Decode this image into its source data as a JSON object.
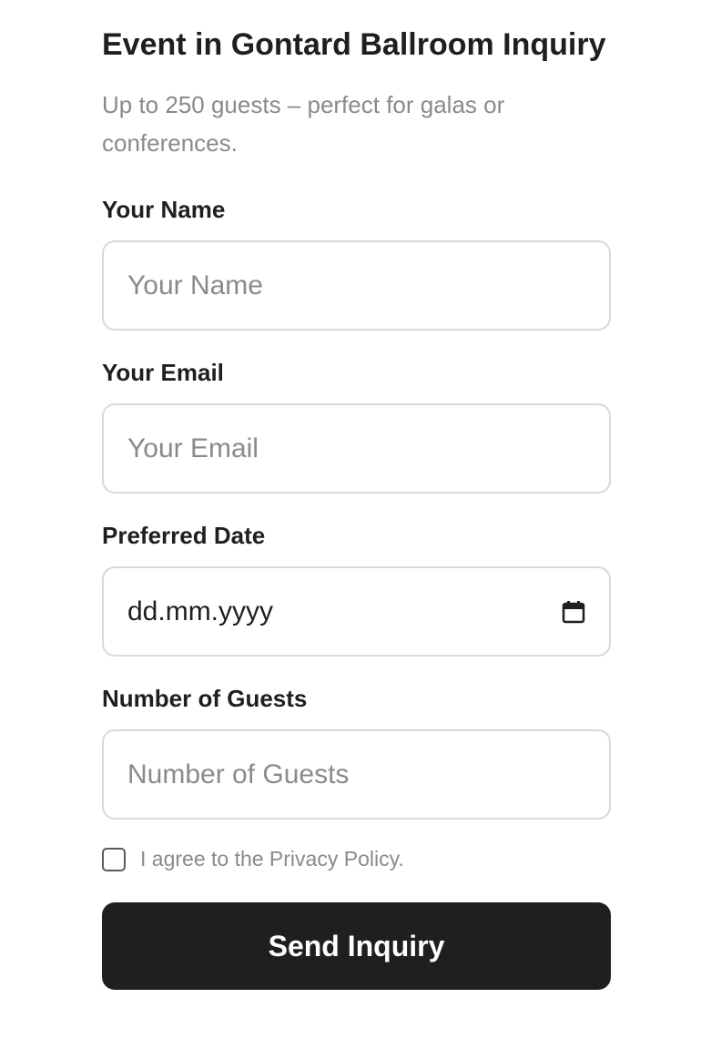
{
  "form": {
    "title": "Event in Gontard Ballroom Inquiry",
    "subtitle": "Up to 250 guests – perfect for galas or conferences.",
    "fields": {
      "name": {
        "label": "Your Name",
        "placeholder": "Your Name",
        "value": ""
      },
      "email": {
        "label": "Your Email",
        "placeholder": "Your Email",
        "value": ""
      },
      "date": {
        "label": "Preferred Date",
        "display": "dd.mm.yyyy",
        "icon": "calendar-icon"
      },
      "guests": {
        "label": "Number of Guests",
        "placeholder": "Number of Guests",
        "value": ""
      }
    },
    "consent": {
      "label": "I agree to the Privacy Policy.",
      "checked": false
    },
    "submit_label": "Send Inquiry"
  },
  "colors": {
    "primary_text": "#1f1f1f",
    "muted_text": "#8a8a8a",
    "border": "#d9d9d9",
    "button_bg": "#1f1f1f",
    "button_text": "#ffffff"
  }
}
